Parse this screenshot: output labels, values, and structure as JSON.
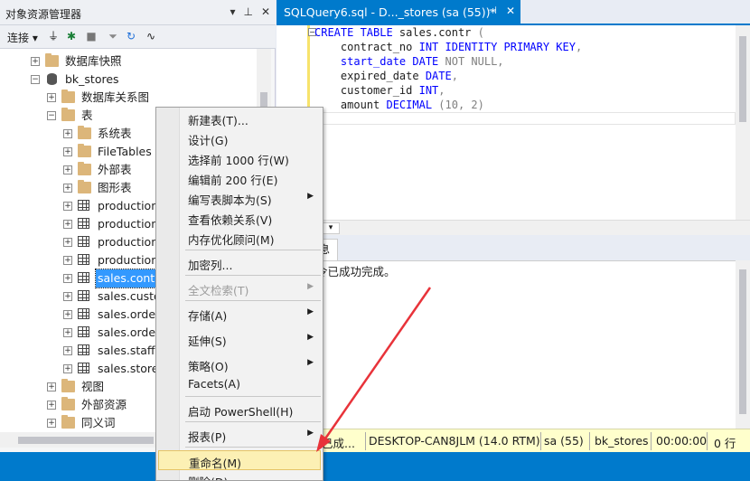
{
  "object_explorer": {
    "title": "对象资源管理器",
    "title_buttons": [
      "▾",
      "⊥",
      "✕"
    ],
    "toolbar": {
      "connect_label": "连接 ▾"
    },
    "tree": [
      {
        "label": "数据库快照",
        "icon": "folder-icon"
      },
      {
        "label": "bk_stores",
        "icon": "database-icon"
      },
      {
        "label": "数据库关系图",
        "icon": "folder-icon"
      },
      {
        "label": "表",
        "icon": "folder-icon"
      },
      {
        "label": "系统表",
        "icon": "folder-icon"
      },
      {
        "label": "FileTables",
        "icon": "folder-icon"
      },
      {
        "label": "外部表",
        "icon": "folder-icon"
      },
      {
        "label": "图形表",
        "icon": "folder-icon"
      },
      {
        "label": "production",
        "icon": "table-icon"
      },
      {
        "label": "production",
        "icon": "table-icon"
      },
      {
        "label": "production",
        "icon": "table-icon"
      },
      {
        "label": "production",
        "icon": "table-icon"
      },
      {
        "label": "sales.contr",
        "icon": "table-icon",
        "selected": true
      },
      {
        "label": "sales.custo",
        "icon": "table-icon"
      },
      {
        "label": "sales.orde",
        "icon": "table-icon"
      },
      {
        "label": "sales.orde",
        "icon": "table-icon"
      },
      {
        "label": "sales.staffs",
        "icon": "table-icon"
      },
      {
        "label": "sales.store",
        "icon": "table-icon"
      },
      {
        "label": "视图",
        "icon": "folder-icon"
      },
      {
        "label": "外部资源",
        "icon": "folder-icon"
      },
      {
        "label": "同义词",
        "icon": "folder-icon"
      }
    ]
  },
  "editor": {
    "tab_title": "SQLQuery6.sql - D..._stores (sa (55))*",
    "tab_pin": "⊣",
    "tab_close": "✕",
    "code_lines": [
      [
        {
          "t": "CREATE TABLE",
          "c": "kw"
        },
        {
          "t": " sales.contr ",
          "c": "bl"
        },
        {
          "t": "(",
          "c": "gr"
        }
      ],
      [
        {
          "t": "    contract_no ",
          "c": "bl"
        },
        {
          "t": "INT IDENTITY PRIMARY KEY",
          "c": "kw"
        },
        {
          "t": ",",
          "c": "gr"
        }
      ],
      [
        {
          "t": "    start_date ",
          "c": "kw"
        },
        {
          "t": "DATE ",
          "c": "kw"
        },
        {
          "t": "NOT NULL",
          "c": "gr"
        },
        {
          "t": ",",
          "c": "gr"
        }
      ],
      [
        {
          "t": "    expired_date ",
          "c": "bl"
        },
        {
          "t": "DATE",
          "c": "kw"
        },
        {
          "t": ",",
          "c": "gr"
        }
      ],
      [
        {
          "t": "    customer_id ",
          "c": "bl"
        },
        {
          "t": "INT",
          "c": "kw"
        },
        {
          "t": ",",
          "c": "gr"
        }
      ],
      [
        {
          "t": "    amount ",
          "c": "bl"
        },
        {
          "t": "DECIMAL ",
          "c": "kw"
        },
        {
          "t": "(10, 2)",
          "c": "gr"
        }
      ],
      [
        {
          "t": "",
          "c": "bl"
        }
      ]
    ],
    "zoom_label": "▾",
    "results_tab_label": "息",
    "results_message": "令已成功完成。"
  },
  "status_bar": {
    "items": [
      "已成...",
      "DESKTOP-CAN8JLM (14.0 RTM)",
      "sa (55)",
      "bk_stores",
      "00:00:00",
      "0 行"
    ]
  },
  "context_menu": {
    "items": [
      {
        "label": "新建表(T)...",
        "submenu": false,
        "disabled": false
      },
      {
        "label": "设计(G)",
        "submenu": false,
        "disabled": false
      },
      {
        "label": "选择前 1000 行(W)",
        "submenu": false,
        "disabled": false
      },
      {
        "label": "编辑前 200 行(E)",
        "submenu": false,
        "disabled": false
      },
      {
        "label": "编写表脚本为(S)",
        "submenu": true,
        "disabled": false
      },
      {
        "label": "查看依赖关系(V)",
        "submenu": false,
        "disabled": false
      },
      {
        "label": "内存优化顾问(M)",
        "submenu": false,
        "disabled": false
      },
      {
        "label": "加密列...",
        "submenu": false,
        "disabled": false
      },
      {
        "label": "全文检索(T)",
        "submenu": true,
        "disabled": true
      },
      {
        "label": "存储(A)",
        "submenu": true,
        "disabled": false
      },
      {
        "label": "延伸(S)",
        "submenu": true,
        "disabled": false
      },
      {
        "label": "策略(O)",
        "submenu": true,
        "disabled": false
      },
      {
        "label": "Facets(A)",
        "submenu": false,
        "disabled": false
      },
      {
        "label": "启动 PowerShell(H)",
        "submenu": false,
        "disabled": false
      },
      {
        "label": "报表(P)",
        "submenu": true,
        "disabled": false
      },
      {
        "label": "重命名(M)",
        "submenu": false,
        "disabled": false,
        "highlighted": true
      },
      {
        "label": "删除(D)",
        "submenu": false,
        "disabled": false
      }
    ]
  },
  "colors": {
    "accent": "#007acc",
    "annotation_arrow": "#e8333a",
    "highlight": "#fcf0b4"
  }
}
